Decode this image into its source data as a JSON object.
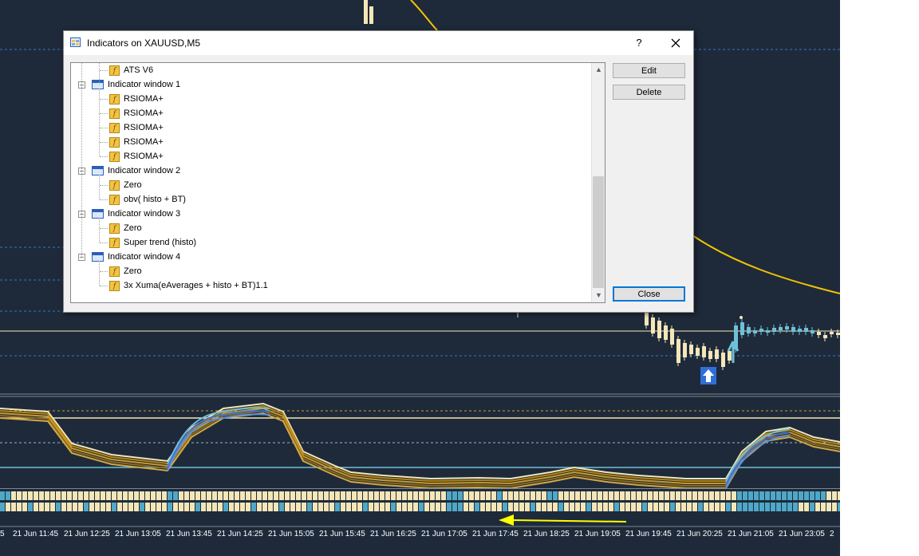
{
  "dialog": {
    "title": "Indicators on XAUUSD,M5",
    "help_label": "?",
    "edit_label": "Edit",
    "delete_label": "Delete",
    "close_label": "Close",
    "tree": [
      {
        "level": 1,
        "kind": "indicator",
        "label": "ATS V6"
      },
      {
        "level": 0,
        "kind": "window",
        "label": "Indicator window 1"
      },
      {
        "level": 1,
        "kind": "indicator",
        "label": "RSIOMA+"
      },
      {
        "level": 1,
        "kind": "indicator",
        "label": "RSIOMA+"
      },
      {
        "level": 1,
        "kind": "indicator",
        "label": "RSIOMA+"
      },
      {
        "level": 1,
        "kind": "indicator",
        "label": "RSIOMA+"
      },
      {
        "level": 1,
        "kind": "indicator",
        "label": "RSIOMA+"
      },
      {
        "level": 0,
        "kind": "window",
        "label": "Indicator window 2"
      },
      {
        "level": 1,
        "kind": "indicator",
        "label": "Zero"
      },
      {
        "level": 1,
        "kind": "indicator",
        "label": "obv( histo + BT)"
      },
      {
        "level": 0,
        "kind": "window",
        "label": "Indicator window 3"
      },
      {
        "level": 1,
        "kind": "indicator",
        "label": "Zero"
      },
      {
        "level": 1,
        "kind": "indicator",
        "label": "Super trend (histo)"
      },
      {
        "level": 0,
        "kind": "window",
        "label": "Indicator window 4"
      },
      {
        "level": 1,
        "kind": "indicator",
        "label": "Zero"
      },
      {
        "level": 1,
        "kind": "indicator",
        "label": "3x Xuma(eAverages + histo + BT)1.1"
      }
    ]
  },
  "chart": {
    "symbol": "XAUUSD",
    "timeframe": "M5",
    "time_axis": [
      "5",
      "21 Jun 11:45",
      "21 Jun 12:25",
      "21 Jun 13:05",
      "21 Jun 13:45",
      "21 Jun 14:25",
      "21 Jun 15:05",
      "21 Jun 15:45",
      "21 Jun 16:25",
      "21 Jun 17:05",
      "21 Jun 17:45",
      "21 Jun 18:25",
      "21 Jun 19:05",
      "21 Jun 19:45",
      "21 Jun 20:25",
      "21 Jun 21:05",
      "21 Jun 23:05",
      "2"
    ],
    "colors": {
      "background": "#1e2a3a",
      "candle": "#f5e6b8",
      "ma_line": "#f2c400",
      "accent_blue": "#6ec0d8",
      "arrow_annotation": "#ffff00"
    }
  },
  "icons": {
    "title_icon": "indicators-list-icon",
    "indicator_icon": "custom-indicator-fx-icon",
    "window_icon": "indicator-window-icon",
    "buy_arrow": "up-arrow-signal-icon"
  }
}
